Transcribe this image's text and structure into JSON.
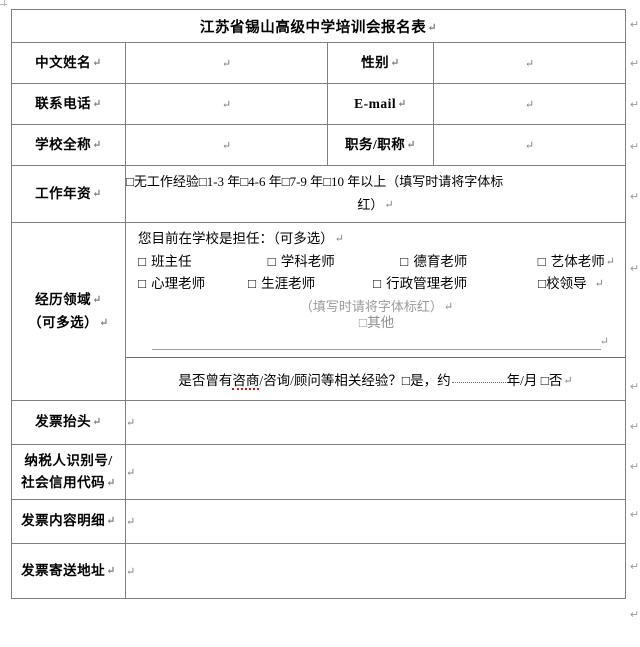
{
  "document": {
    "title": "江苏省锡山高级中学培训会报名表",
    "pilcrow": "↵"
  },
  "rows": {
    "name_label": "中文姓名",
    "name_value": "",
    "gender_label": "性别",
    "gender_value": "",
    "phone_label": "联系电话",
    "phone_value": "",
    "email_label": "E-mail",
    "email_value": "",
    "school_label": "学校全称",
    "school_value": "",
    "position_label": "职务/职称",
    "position_value": "",
    "years_label": "工作年资",
    "years_line1": "□无工作经验□1-3 年□4-6 年□7-9 年□10 年以上（填写时请将字体标",
    "years_line2": "红）",
    "experience_label_line1": "经历领域",
    "experience_label_line2": "（可多选）"
  },
  "experience": {
    "question": "您目前在学校是担任：（可多选）",
    "checkbox_row1": [
      {
        "box": "□",
        "label": "班主任"
      },
      {
        "box": "□",
        "label": "学科老师"
      },
      {
        "box": "□",
        "label": "德育老师"
      },
      {
        "box": "□",
        "label": "艺体老师"
      }
    ],
    "checkbox_row2": [
      {
        "box": "□",
        "label": "心理老师"
      },
      {
        "box": "□",
        "label": "生涯老师"
      },
      {
        "box": "□",
        "label": "行政管理老师"
      },
      {
        "box": "□",
        "label": "校领导"
      }
    ],
    "note": "（填写时请将字体标红）",
    "other_option": "□其他",
    "write_in_value": "",
    "consult_q_part1": "是否曾有",
    "consult_q_misspelled": "咨商",
    "consult_q_part2": "/咨询/顾问等相关经验？",
    "consult_yes": "□是，约",
    "consult_unit": "年/月",
    "consult_no": "□否"
  },
  "invoice": {
    "title_label": "发票抬头",
    "title_value": "",
    "taxid_label_line1": "纳税人识别号/",
    "taxid_label_line2": "社会信用代码",
    "taxid_value": "",
    "detail_label": "发票内容明细",
    "detail_value": "",
    "address_label": "发票寄送地址",
    "address_value": ""
  },
  "colors": {
    "title_background": "#cfcfcf",
    "border": "#808080",
    "note_gray": "#9b9b9b",
    "spellcheck_red": "#d01515"
  }
}
